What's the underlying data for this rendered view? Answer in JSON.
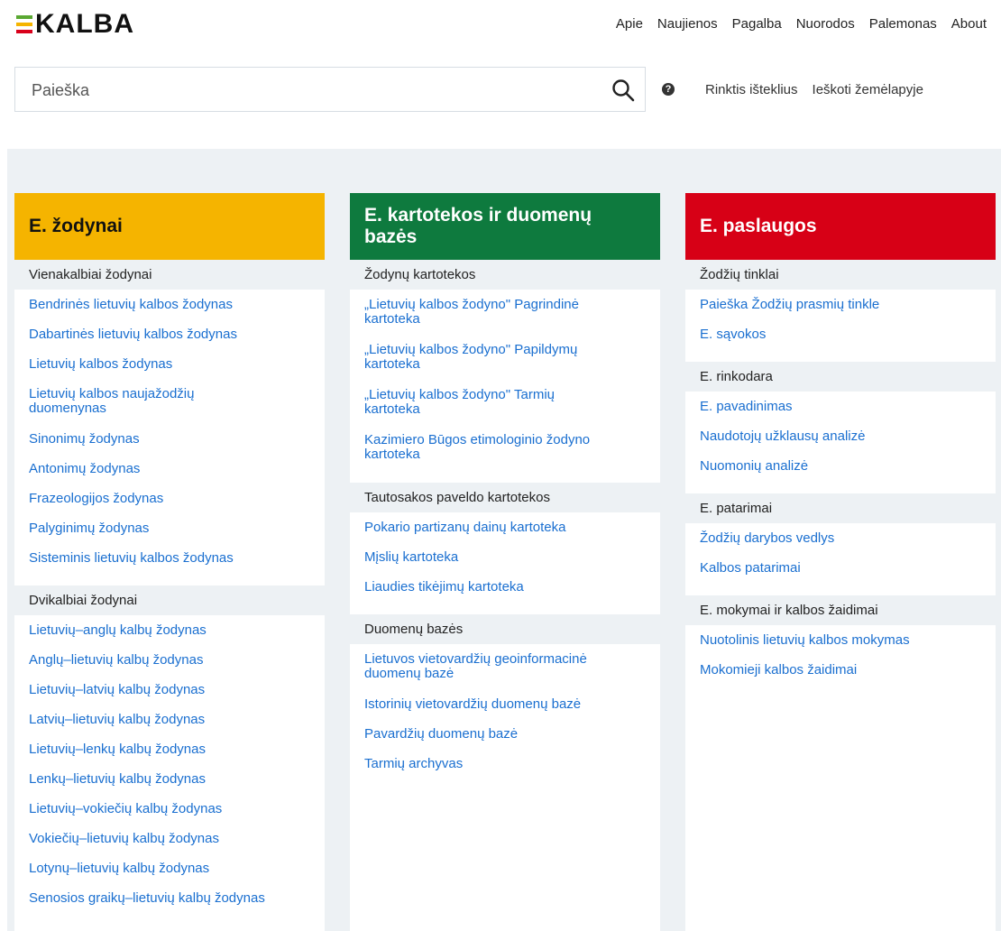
{
  "header": {
    "logo_text": "KALBA",
    "nav": [
      "Apie",
      "Naujienos",
      "Pagalba",
      "Nuorodos",
      "Palemonas",
      "About"
    ]
  },
  "search": {
    "placeholder": "Paieška",
    "help_glyph": "?",
    "links": [
      "Rinktis išteklius",
      "Ieškoti žemėlapyje"
    ]
  },
  "columns": [
    {
      "title": "E. žodynai",
      "accent": "#f5b400",
      "sections": [
        {
          "title": "Vienakalbiai žodynai",
          "links": [
            "Bendrinės lietuvių kalbos žodynas",
            "Dabartinės lietuvių kalbos žodynas",
            "Lietuvių kalbos žodynas",
            "Lietuvių kalbos naujažodžių duomenynas",
            "Sinonimų žodynas",
            "Antonimų žodynas",
            "Frazeologijos žodynas",
            "Palyginimų žodynas",
            "Sisteminis lietuvių kalbos žodynas"
          ]
        },
        {
          "title": "Dvikalbiai žodynai",
          "links": [
            "Lietuvių–anglų kalbų žodynas",
            "Anglų–lietuvių kalbų žodynas",
            "Lietuvių–latvių kalbų žodynas",
            "Latvių–lietuvių kalbų žodynas",
            "Lietuvių–lenkų kalbų žodynas",
            "Lenkų–lietuvių kalbų žodynas",
            "Lietuvių–vokiečių kalbų žodynas",
            "Vokiečių–lietuvių kalbų žodynas",
            "Lotynų–lietuvių kalbų žodynas",
            "Senosios graikų–lietuvių kalbų žodynas"
          ]
        }
      ]
    },
    {
      "title": "E. kartotekos ir duomenų bazės",
      "accent": "#0e7a3e",
      "sections": [
        {
          "title": "Žodynų kartotekos",
          "links": [
            "„Lietuvių kalbos žodyno\" Pagrindinė kartoteka",
            "„Lietuvių kalbos žodyno\" Papildymų kartoteka",
            "„Lietuvių kalbos žodyno\" Tarmių kartoteka",
            "Kazimiero Būgos etimologinio žodyno kartoteka"
          ]
        },
        {
          "title": "Tautosakos paveldo kartotekos",
          "links": [
            "Pokario partizanų dainų kartoteka",
            "Mįslių kartoteka",
            "Liaudies tikėjimų kartoteka"
          ]
        },
        {
          "title": "Duomenų bazės",
          "links": [
            "Lietuvos vietovardžių geoinformacinė duomenų bazė",
            "Istorinių vietovardžių duomenų bazė",
            "Pavardžių duomenų bazė",
            "Tarmių archyvas"
          ]
        }
      ]
    },
    {
      "title": "E. paslaugos",
      "accent": "#d70016",
      "sections": [
        {
          "title": "Žodžių tinklai",
          "links": [
            "Paieška Žodžių prasmių tinkle",
            "E. sąvokos"
          ]
        },
        {
          "title": "E. rinkodara",
          "links": [
            "E. pavadinimas",
            "Naudotojų užklausų analizė",
            "Nuomonių analizė"
          ]
        },
        {
          "title": "E. patarimai",
          "links": [
            "Žodžių darybos vedlys",
            "Kalbos patarimai"
          ]
        },
        {
          "title": "E. mokymai ir kalbos žaidimai",
          "links": [
            "Nuotolinis lietuvių kalbos mokymas",
            "Mokomieji kalbos žaidimai"
          ]
        }
      ]
    }
  ]
}
